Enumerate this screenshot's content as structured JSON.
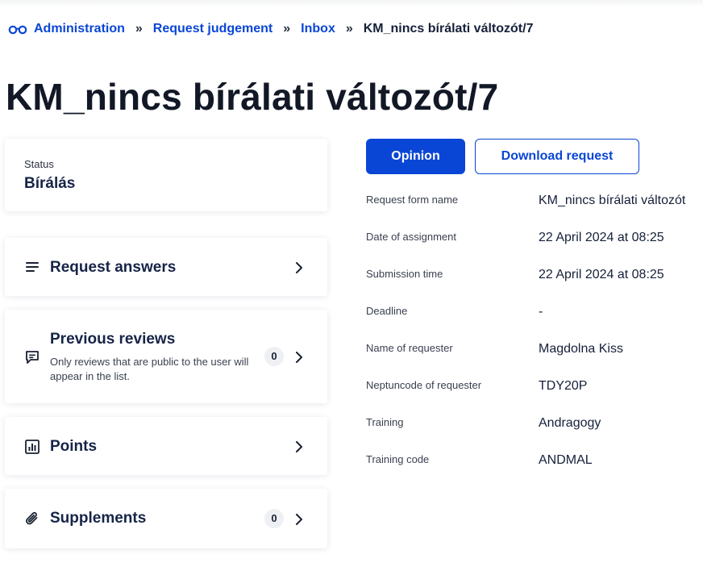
{
  "breadcrumb": {
    "items": [
      {
        "label": "Administration"
      },
      {
        "label": "Request judgement"
      },
      {
        "label": "Inbox"
      }
    ],
    "separator": "»",
    "current": "KM_nincs bírálati változót/7"
  },
  "page": {
    "title": "KM_nincs bírálati változót/7"
  },
  "status": {
    "label": "Status",
    "value": "Bírálás"
  },
  "sections": {
    "request_answers": {
      "title": "Request answers",
      "icon": "list-icon"
    },
    "previous_reviews": {
      "title": "Previous reviews",
      "description": "Only reviews that are public to the user will appear in the list.",
      "count": "0",
      "icon": "comment-icon"
    },
    "points": {
      "title": "Points",
      "icon": "bar-chart-icon"
    },
    "supplements": {
      "title": "Supplements",
      "count": "0",
      "icon": "paperclip-icon"
    }
  },
  "actions": {
    "opinion_label": "Opinion",
    "download_label": "Download request"
  },
  "details": [
    {
      "label": "Request form name",
      "value": "KM_nincs bírálati változót"
    },
    {
      "label": "Date of assignment",
      "value": "22 April 2024 at 08:25"
    },
    {
      "label": "Submission time",
      "value": "22 April 2024 at 08:25"
    },
    {
      "label": "Deadline",
      "value": "-"
    },
    {
      "label": "Name of requester",
      "value": "Magdolna Kiss"
    },
    {
      "label": "Neptuncode of requester",
      "value": "TDY20P"
    },
    {
      "label": "Training",
      "value": "Andragogy"
    },
    {
      "label": "Training code",
      "value": "ANDMAL"
    }
  ],
  "colors": {
    "accent": "#0a46d6",
    "heading": "#162447"
  }
}
